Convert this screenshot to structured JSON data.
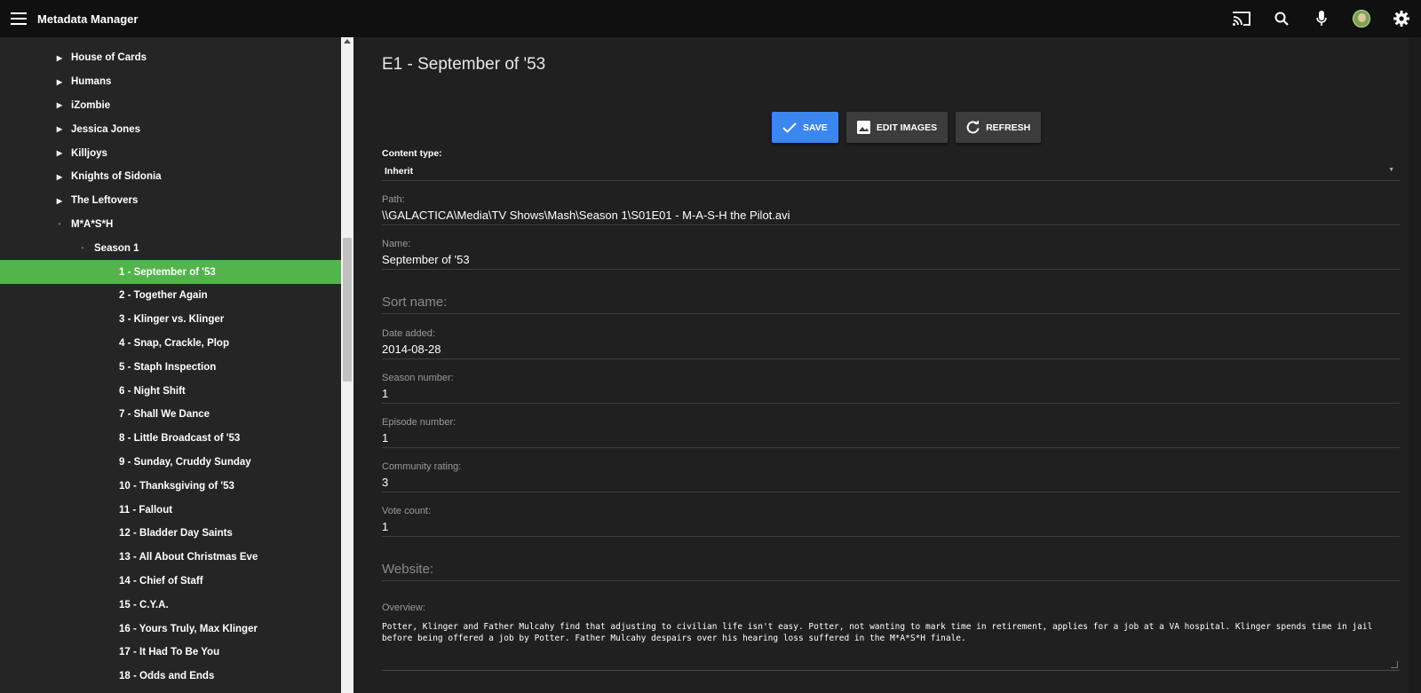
{
  "app": {
    "title": "Metadata Manager"
  },
  "topbar": {
    "icons": [
      "menu-icon",
      "cast-icon",
      "search-icon",
      "mic-icon",
      "avatar",
      "gear-icon"
    ]
  },
  "tree": [
    {
      "label": "House of Cards",
      "level": 1,
      "expander": "collapsed"
    },
    {
      "label": "Humans",
      "level": 1,
      "expander": "collapsed"
    },
    {
      "label": "iZombie",
      "level": 1,
      "expander": "collapsed"
    },
    {
      "label": "Jessica Jones",
      "level": 1,
      "expander": "collapsed"
    },
    {
      "label": "Killjoys",
      "level": 1,
      "expander": "collapsed"
    },
    {
      "label": "Knights of Sidonia",
      "level": 1,
      "expander": "collapsed"
    },
    {
      "label": "The Leftovers",
      "level": 1,
      "expander": "collapsed"
    },
    {
      "label": "M*A*S*H",
      "level": 1,
      "expander": "expanded"
    },
    {
      "label": "Season 1",
      "level": 2,
      "expander": "expanded"
    },
    {
      "label": "1 - September of '53",
      "level": 3,
      "selected": true
    },
    {
      "label": "2 - Together Again",
      "level": 3
    },
    {
      "label": "3 - Klinger vs. Klinger",
      "level": 3
    },
    {
      "label": "4 - Snap, Crackle, Plop",
      "level": 3
    },
    {
      "label": "5 - Staph Inspection",
      "level": 3
    },
    {
      "label": "6 - Night Shift",
      "level": 3
    },
    {
      "label": "7 - Shall We Dance",
      "level": 3
    },
    {
      "label": "8 - Little Broadcast of '53",
      "level": 3
    },
    {
      "label": "9 - Sunday, Cruddy Sunday",
      "level": 3
    },
    {
      "label": "10 - Thanksgiving of '53",
      "level": 3
    },
    {
      "label": "11 - Fallout",
      "level": 3
    },
    {
      "label": "12 - Bladder Day Saints",
      "level": 3
    },
    {
      "label": "13 - All About Christmas Eve",
      "level": 3
    },
    {
      "label": "14 - Chief of Staff",
      "level": 3
    },
    {
      "label": "15 - C.Y.A.",
      "level": 3
    },
    {
      "label": "16 - Yours Truly, Max Klinger",
      "level": 3
    },
    {
      "label": "17 - It Had To Be You",
      "level": 3
    },
    {
      "label": "18 - Odds and Ends",
      "level": 3
    }
  ],
  "main": {
    "title": "E1 - September of '53",
    "buttons": {
      "save": "SAVE",
      "edit_images": "EDIT IMAGES",
      "refresh": "REFRESH"
    },
    "content_type": {
      "label": "Content type:",
      "value": "Inherit"
    },
    "path": {
      "label": "Path:",
      "value": "\\\\GALACTICA\\Media\\TV Shows\\Mash\\Season 1\\S01E01 - M-A-S-H the Pilot.avi"
    },
    "name": {
      "label": "Name:",
      "value": "September of '53"
    },
    "sort_name": {
      "placeholder": "Sort name:"
    },
    "date_added": {
      "label": "Date added:",
      "value": "2014-08-28"
    },
    "season_number": {
      "label": "Season number:",
      "value": "1"
    },
    "episode_number": {
      "label": "Episode number:",
      "value": "1"
    },
    "community_rating": {
      "label": "Community rating:",
      "value": "3"
    },
    "vote_count": {
      "label": "Vote count:",
      "value": "1"
    },
    "website": {
      "placeholder": "Website:"
    },
    "overview": {
      "label": "Overview:",
      "value": "Potter, Klinger and Father Mulcahy find that adjusting to civilian life isn't easy. Potter, not wanting to mark time in retirement, applies for a job at a VA hospital. Klinger spends time in jail before being offered a job by Potter. Father Mulcahy despairs over his hearing loss suffered in the M*A*S*H finale."
    }
  },
  "colors": {
    "accent_green": "#52b54b",
    "save_blue": "#3b86ef",
    "topbar": "#101010"
  }
}
